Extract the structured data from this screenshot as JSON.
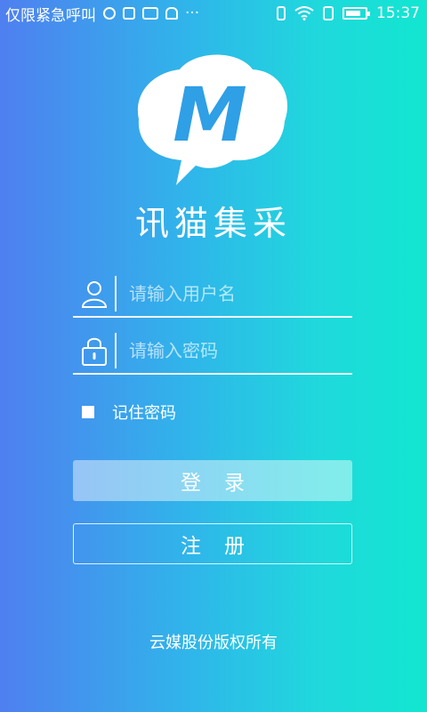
{
  "status_bar": {
    "carrier": "仅限紧急呼叫",
    "time": "15:37",
    "icons": [
      "sim-icon",
      "alarm-icon",
      "keyboard-icon",
      "android-icon",
      "more-icon",
      "vibrate-icon",
      "wifi-icon",
      "sim-card-icon",
      "battery-icon"
    ],
    "more": "···"
  },
  "app": {
    "title": "讯猫集采",
    "logo_letter": "M"
  },
  "form": {
    "username_placeholder": "请输入用户名",
    "password_placeholder": "请输入密码",
    "remember_label": "记住密码",
    "login_label": "登录",
    "register_label": "注册"
  },
  "footer": {
    "copyright": "云媒股份版权所有"
  },
  "colors": {
    "gradient_start": "#4f7ff0",
    "gradient_end": "#12e6d0",
    "logo_letter": "#2f9fe6"
  }
}
